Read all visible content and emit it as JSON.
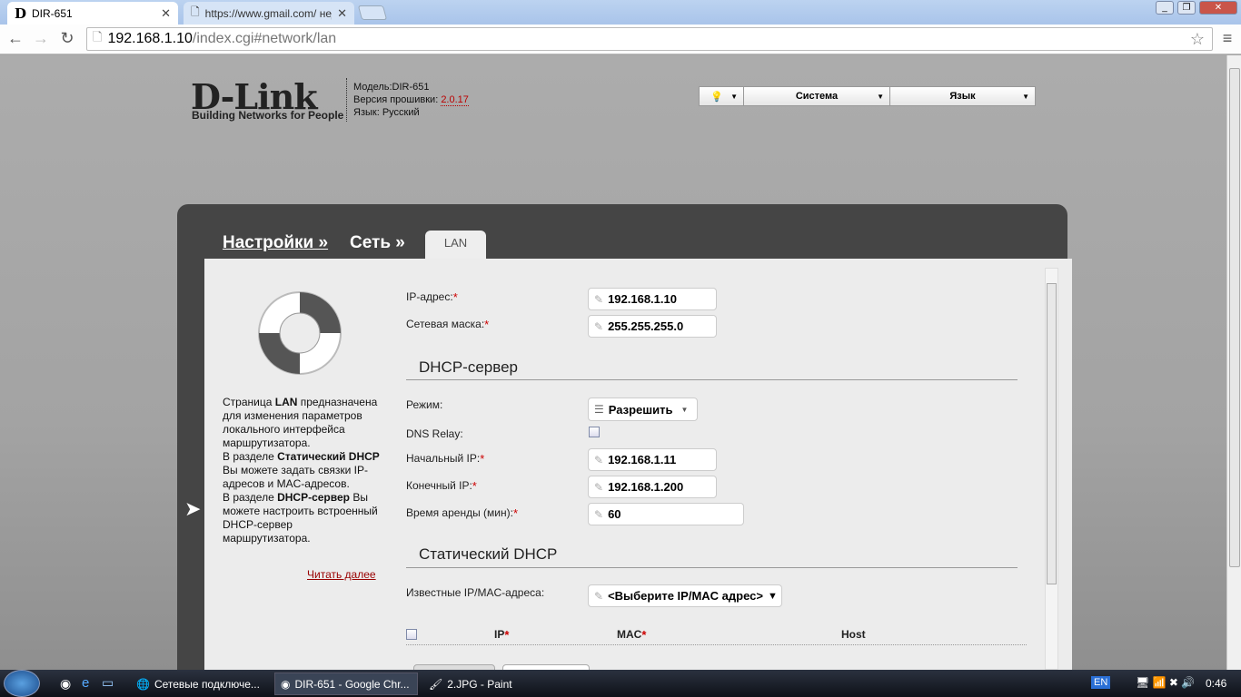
{
  "browser": {
    "tabs": [
      {
        "label": "DIR-651",
        "icon": "dlink-favicon"
      },
      {
        "label": "https://www.gmail.com/ нед",
        "icon": "page-icon"
      }
    ],
    "url_host": "192.168.1.10",
    "url_path": "/index.cgi#network/lan"
  },
  "header": {
    "logo": "D-Link",
    "tagline": "Building Networks for People",
    "model": "Модель:DIR-651",
    "firmware_label": "Версия прошивки:",
    "firmware_version": "2.0.17",
    "language": "Язык: Русский",
    "menu": {
      "system": "Система",
      "language": "Язык"
    }
  },
  "breadcrumb": {
    "settings": "Настройки »",
    "network": "Сеть »",
    "tab": "LAN"
  },
  "help": {
    "p1_pre": "Страница ",
    "p1_bold": "LAN",
    "p1_post": " предназначена для изменения параметров локального интерфейса маршрутизатора.",
    "p2_pre": "В разделе ",
    "p2_bold": "Статический DHCP",
    "p2_post": " Вы можете задать связки IP-адресов и MAC-адресов.",
    "p3_pre": "В разделе ",
    "p3_bold": "DHCP-сервер",
    "p3_post": " Вы можете настроить встроенный DHCP-сервер маршрутизатора.",
    "more": "Читать далее"
  },
  "form": {
    "ip_label": "IP-адрес:",
    "ip": "192.168.1.10",
    "mask_label": "Сетевая маска:",
    "mask": "255.255.255.0",
    "dhcp_title": "DHCP-сервер",
    "mode_label": "Режим:",
    "mode": "Разрешить",
    "dns_relay_label": "DNS Relay:",
    "dns_relay": false,
    "start_label": "Начальный IP:",
    "start": "192.168.1.11",
    "end_label": "Конечный IP:",
    "end": "192.168.1.200",
    "lease_label": "Время аренды (мин):",
    "lease": "60",
    "static_title": "Статический DHCP",
    "known_label": "Известные IP/MAC-адреса:",
    "known": "<Выберите IP/MAC адрес>",
    "table_headers": {
      "ip": "IP",
      "mac": "MAC",
      "host": "Host"
    }
  },
  "taskbar": {
    "items": [
      "Сетевые подключе...",
      "DIR-651 - Google Chr...",
      "2.JPG - Paint"
    ],
    "lang": "EN",
    "clock": "0:46"
  }
}
